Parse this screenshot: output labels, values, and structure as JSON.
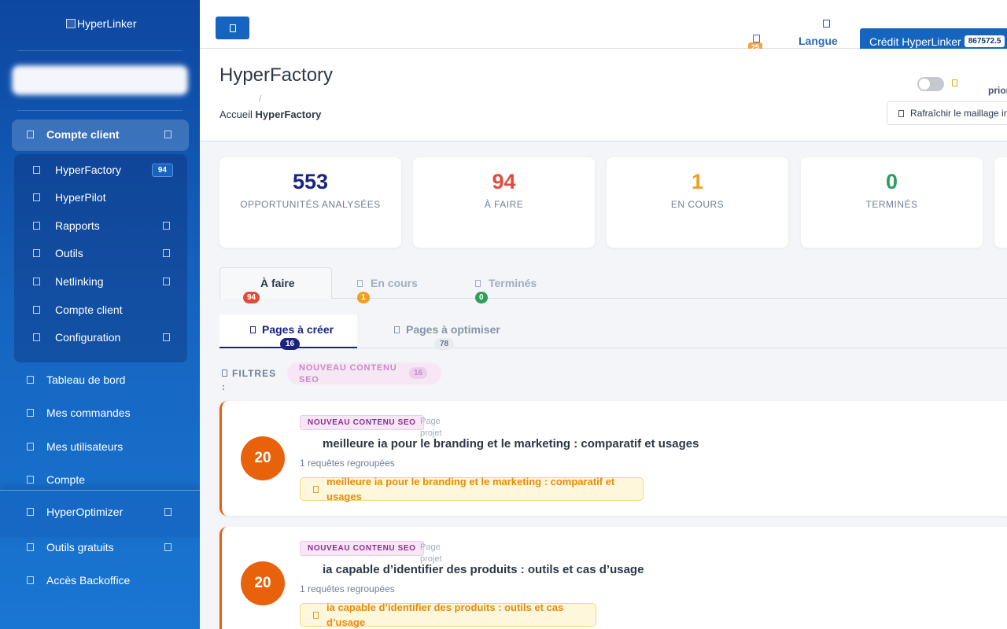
{
  "sidebar": {
    "logo_alt": "HyperLinker",
    "section_main": "Compte client",
    "items": [
      {
        "label": "HyperFactory",
        "badge": "94"
      },
      {
        "label": "HyperPilot"
      },
      {
        "label": "Rapports"
      },
      {
        "label": "Outils"
      },
      {
        "label": "Netlinking"
      },
      {
        "label": "Compte client"
      },
      {
        "label": "Configuration"
      }
    ],
    "top_items": [
      {
        "label": "Tableau de bord"
      },
      {
        "label": "Mes commandes"
      },
      {
        "label": "Mes utilisateurs"
      },
      {
        "label": "Compte"
      },
      {
        "label": "HyperOptimizer"
      },
      {
        "label": "Outils gratuits"
      },
      {
        "label": "Accès Backoffice"
      }
    ]
  },
  "topbar": {
    "notif_count": "25",
    "lang_label": "Langue",
    "credit_label": "Crédit HyperLinker",
    "credit_value": "867572.5"
  },
  "header": {
    "title": "HyperFactory",
    "breadcrumb_sep": "/",
    "breadcrumb_home": "Accueil",
    "breadcrumb_current": "HyperFactory",
    "priority_label": "prior",
    "refresh_label": "Rafraîchir le maillage in"
  },
  "stats": [
    {
      "value": "553",
      "label": "OPPORTUNITÉS ANALYSÉES",
      "color": "#1a237e"
    },
    {
      "value": "94",
      "label": "À FAIRE",
      "color": "#e04b3c"
    },
    {
      "value": "1",
      "label": "EN COURS",
      "color": "#f0a020"
    },
    {
      "value": "0",
      "label": "TERMINÉS",
      "color": "#2e9e5b"
    }
  ],
  "tabs": [
    {
      "label": "À faire",
      "count": "94",
      "badge_color": "#e04b3c"
    },
    {
      "label": "En cours",
      "count": "1",
      "badge_color": "#f0a020"
    },
    {
      "label": "Terminés",
      "count": "0",
      "badge_color": "#2e9e5b"
    }
  ],
  "subtabs": [
    {
      "label": "Pages à créer",
      "count": "16"
    },
    {
      "label": "Pages à optimiser",
      "count": "78"
    }
  ],
  "filters": {
    "label": "FILTRES",
    "colon": ":",
    "chip_label": "NOUVEAU CONTENU SEO",
    "chip_count": "16"
  },
  "opportunities": [
    {
      "score": "20",
      "tag": "NOUVEAU CONTENU SEO",
      "page_type": "Page projet",
      "title": "meilleure ia pour le branding et le marketing : comparatif et usages",
      "subtitle": "1 requêtes regroupées",
      "keyword": "meilleure ia pour le branding et le marketing : comparatif et usages"
    },
    {
      "score": "20",
      "tag": "NOUVEAU CONTENU SEO",
      "page_type": "Page projet",
      "title": "ia capable d’identifier des produits : outils et cas d’usage",
      "subtitle": "1 requêtes regroupées",
      "keyword": "ia capable d’identifier des produits : outils et cas d’usage"
    }
  ]
}
